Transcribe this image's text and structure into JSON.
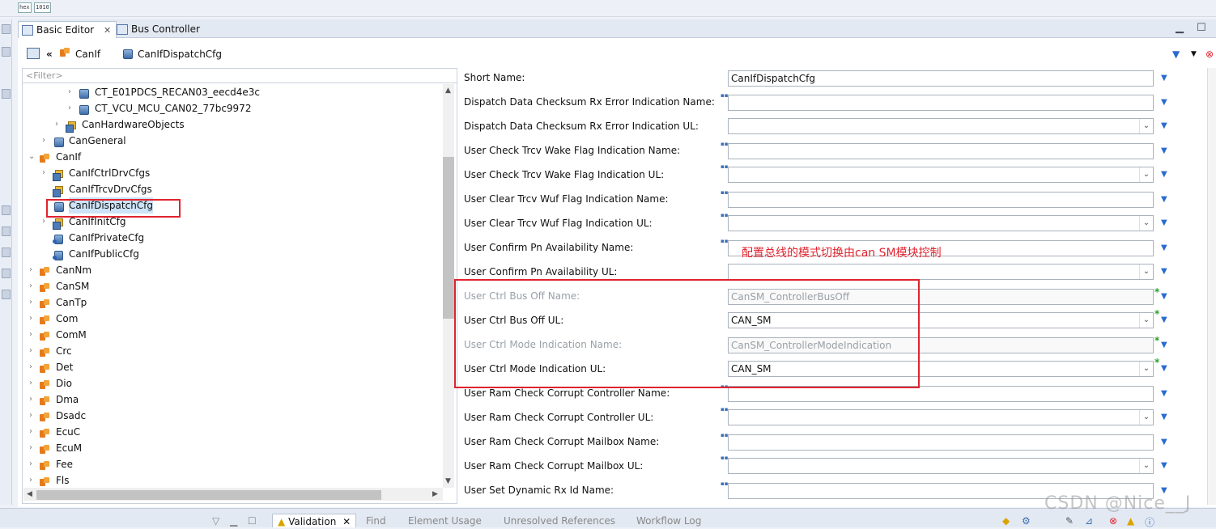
{
  "toolbar": {
    "hex_label": "hex",
    "bits_label": "1010"
  },
  "tabs": [
    {
      "label": "Basic Editor",
      "close": "✕"
    },
    {
      "label": "Bus Controller"
    }
  ],
  "breadcrumb": {
    "back": "«",
    "module": "CanIf",
    "item": "CanIfDispatchCfg"
  },
  "tree": {
    "filter_placeholder": "<Filter>",
    "items": [
      {
        "label": "CT_E01PDCS_RECAN03_eecd4e3c"
      },
      {
        "label": "CT_VCU_MCU_CAN02_77bc9972"
      },
      {
        "label": "CanHardwareObjects"
      },
      {
        "label": "CanGeneral"
      },
      {
        "label": "CanIf"
      },
      {
        "label": "CanIfCtrlDrvCfgs"
      },
      {
        "label": "CanIfTrcvDrvCfgs"
      },
      {
        "label": "CanIfDispatchCfg"
      },
      {
        "label": "CanIfInitCfg"
      },
      {
        "label": "CanIfPrivateCfg"
      },
      {
        "label": "CanIfPublicCfg"
      },
      {
        "label": "CanNm"
      },
      {
        "label": "CanSM"
      },
      {
        "label": "CanTp"
      },
      {
        "label": "Com"
      },
      {
        "label": "ComM"
      },
      {
        "label": "Crc"
      },
      {
        "label": "Det"
      },
      {
        "label": "Dio"
      },
      {
        "label": "Dma"
      },
      {
        "label": "Dsadc"
      },
      {
        "label": "EcuC"
      },
      {
        "label": "EcuM"
      },
      {
        "label": "Fee"
      },
      {
        "label": "Fls"
      }
    ]
  },
  "form": {
    "fields": [
      {
        "label": "Short Name:",
        "value": "CanIfDispatchCfg"
      },
      {
        "label": "Dispatch Data Checksum Rx Error Indication Name:",
        "value": ""
      },
      {
        "label": "Dispatch Data Checksum Rx Error Indication UL:",
        "value": ""
      },
      {
        "label": "User Check Trcv Wake Flag Indication Name:",
        "value": ""
      },
      {
        "label": "User Check Trcv Wake Flag Indication UL:",
        "value": ""
      },
      {
        "label": "User Clear Trcv Wuf Flag Indication Name:",
        "value": ""
      },
      {
        "label": "User Clear Trcv Wuf Flag Indication UL:",
        "value": ""
      },
      {
        "label": "User Confirm Pn Availability Name:",
        "value": ""
      },
      {
        "label": "User Confirm Pn Availability UL:",
        "value": ""
      },
      {
        "label": "User Ctrl Bus Off Name:",
        "value": "CanSM_ControllerBusOff"
      },
      {
        "label": "User Ctrl Bus Off UL:",
        "value": "CAN_SM"
      },
      {
        "label": "User Ctrl Mode Indication Name:",
        "value": "CanSM_ControllerModeIndication"
      },
      {
        "label": "User Ctrl Mode Indication UL:",
        "value": "CAN_SM"
      },
      {
        "label": "User Ram Check Corrupt Controller Name:",
        "value": ""
      },
      {
        "label": "User Ram Check Corrupt Controller UL:",
        "value": ""
      },
      {
        "label": "User Ram Check Corrupt Mailbox Name:",
        "value": ""
      },
      {
        "label": "User Ram Check Corrupt Mailbox UL:",
        "value": ""
      },
      {
        "label": "User Set Dynamic Rx Id Name:",
        "value": ""
      }
    ],
    "annotation": "配置总线的模式切换由can SM模块控制",
    "required_mark": "*",
    "dropdown_glyph": "▼",
    "combo_glyph": "⌄"
  },
  "bottom": {
    "tabs": [
      {
        "label": "Validation"
      },
      {
        "label": "Find"
      },
      {
        "label": "Element Usage"
      },
      {
        "label": "Unresolved References"
      },
      {
        "label": "Workflow Log"
      }
    ]
  },
  "watermark": "CSDN @Nice__J",
  "colors": {
    "highlight": "#e0242f",
    "accent": "#2b6bd1",
    "required": "#27a02b"
  }
}
